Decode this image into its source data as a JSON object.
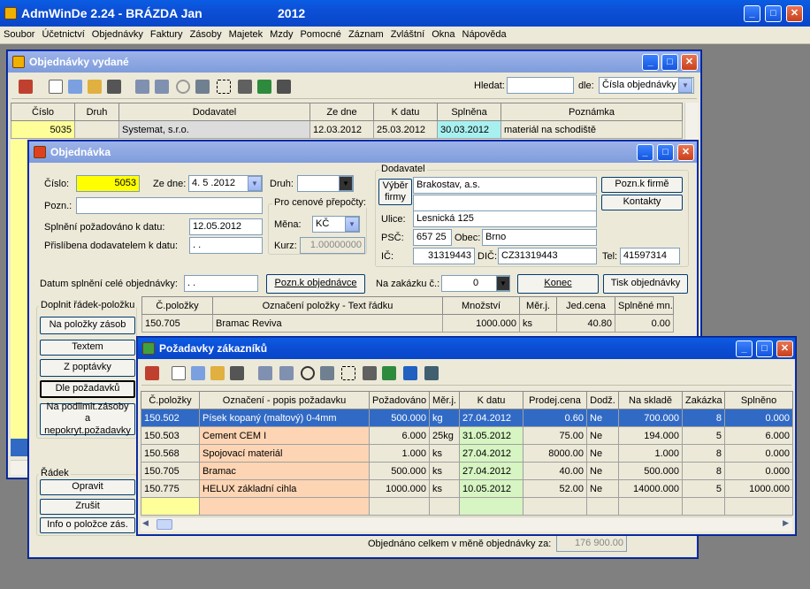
{
  "app": {
    "title": "AdmWinDe 2.24 - BRÁZDA Jan",
    "year": "2012"
  },
  "menu": [
    "Soubor",
    "Účetnictví",
    "Objednávky",
    "Faktury",
    "Zásoby",
    "Majetek",
    "Mzdy",
    "Pomocné",
    "Záznam",
    "Zvláštní",
    "Okna",
    "Nápověda"
  ],
  "orders": {
    "title": "Objednávky vydané",
    "search_label": "Hledat:",
    "by_label": "dle:",
    "by_value": "Čísla objednávky",
    "columns": [
      "Číslo",
      "Druh",
      "Dodavatel",
      "Ze dne",
      "K datu",
      "Splněna",
      "Poznámka"
    ],
    "row": {
      "cislo": "5035",
      "druh": "",
      "dodavatel": "Systemat, s.r.o.",
      "ze_dne": "12.03.2012",
      "k_datu": "25.03.2012",
      "splnena": "30.03.2012",
      "poznamka": "materiál na schodiště"
    }
  },
  "order": {
    "title": "Objednávka",
    "cislo_label": "Číslo:",
    "cislo": "5053",
    "ze_dne_label": "Ze dne:",
    "ze_dne": "4. 5 .2012",
    "druh_label": "Druh:",
    "pozn_label": "Pozn.:",
    "splneni_label": "Splnění požadováno k datu:",
    "splneni": "12.05.2012",
    "prislibena_label": "Přislíbena dodavatelem k datu:",
    "prislibena": ". .",
    "prepocty_title": "Pro cenové přepočty:",
    "mena_label": "Měna:",
    "mena": "KČ",
    "kurz_label": "Kurz:",
    "kurz": "1.00000000",
    "dodavatel_title": "Dodavatel",
    "vyber_firmy": "Výběr firmy",
    "firma": "Brakostav, a.s.",
    "ulice_label": "Ulice:",
    "ulice": "Lesnická 125",
    "psc_label": "PSČ:",
    "psc": "657 25",
    "obec_label": "Obec:",
    "obec": "Brno",
    "ic_label": "IČ:",
    "ic": "31319443",
    "dic_label": "DIČ:",
    "dic": "CZ31319443",
    "tel_label": "Tel:",
    "tel": "41597314",
    "pozn_firme": "Pozn.k firmě",
    "kontakty": "Kontakty",
    "datum_splneni_label": "Datum splnění celé objednávky:",
    "datum_splneni": ". .",
    "pozn_objednavce": "Pozn.k objednávce",
    "na_zakazku_label": "Na zakázku č.:",
    "na_zakazku": "0",
    "konec": "Konec",
    "tisk": "Tisk objednávky",
    "doplnit_title": "Doplnit řádek-položku",
    "btn_zasob": "Na položky zásob",
    "btn_textem": "Textem",
    "btn_poptavky": "Z poptávky",
    "btn_pozadavku": "Dle požadavků",
    "btn_podlimit": "Na podlimit.zásoby a nepokryt.požadavky",
    "radek_title": "Řádek",
    "btn_opravit": "Opravit",
    "btn_zrusit": "Zrušit",
    "btn_info": "Info o položce zás.",
    "columns": [
      "Č.položky",
      "Označení položky - Text řádku",
      "Množství",
      "Měr.j.",
      "Jed.cena",
      "Splněné mn."
    ],
    "row": {
      "polozka": "150.705",
      "oznaceni": "Bramac Reviva",
      "mnozstvi": "1000.000",
      "merj": "ks",
      "cena": "40.80",
      "splnene": "0.00"
    },
    "celkem_label": "Objednáno celkem v měně objednávky za:",
    "celkem": "176 900.00"
  },
  "req": {
    "title": "Požadavky zákazníků",
    "columns": [
      "Č.položky",
      "Označení - popis požadavku",
      "Požadováno",
      "Měr.j.",
      "K datu",
      "Prodej.cena",
      "Dodž.",
      "Na skladě",
      "Zakázka",
      "Splněno"
    ],
    "rows": [
      [
        "150.502",
        "Písek kopaný (maltový) 0-4mm",
        "500.000",
        "kg",
        "27.04.2012",
        "0.60",
        "Ne",
        "700.000",
        "8",
        "0.000"
      ],
      [
        "150.503",
        "Cement CEM I",
        "6.000",
        "25kg",
        "31.05.2012",
        "75.00",
        "Ne",
        "194.000",
        "5",
        "6.000"
      ],
      [
        "150.568",
        "Spojovací materiál",
        "1.000",
        "ks",
        "27.04.2012",
        "8000.00",
        "Ne",
        "1.000",
        "8",
        "0.000"
      ],
      [
        "150.705",
        "Bramac",
        "500.000",
        "ks",
        "27.04.2012",
        "40.00",
        "Ne",
        "500.000",
        "8",
        "0.000"
      ],
      [
        "150.775",
        "HELUX základní cihla",
        "1000.000",
        "ks",
        "10.05.2012",
        "52.00",
        "Ne",
        "14000.000",
        "5",
        "1000.000"
      ]
    ]
  },
  "colors": {
    "title_active": "#0a5de3",
    "highlight": "#316ac5",
    "yellow": "#ffff00",
    "orange": "#fdd5b4",
    "green": "#d6f5c2",
    "cyan": "#a8f0f0"
  }
}
